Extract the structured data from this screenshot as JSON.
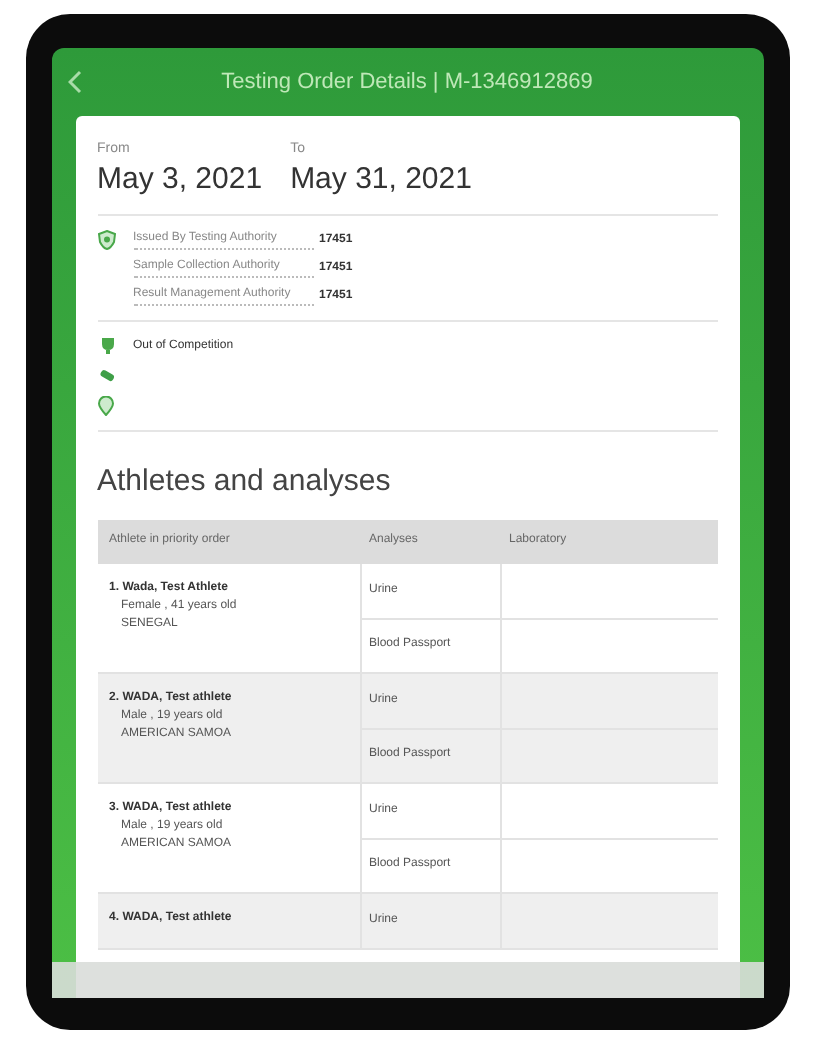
{
  "header": {
    "title": "Testing Order Details | M-1346912869"
  },
  "dates": [
    {
      "label": "From",
      "value": "May 3, 2021"
    },
    {
      "label": "To",
      "value": "May 31, 2021"
    }
  ],
  "authorities": [
    {
      "label": "Issued By Testing Authority",
      "value": "17451"
    },
    {
      "label": "Sample Collection Authority",
      "value": "17451"
    },
    {
      "label": "Result Management Authority",
      "value": "17451"
    }
  ],
  "competition": {
    "label": "Out of Competition"
  },
  "section_title": "Athletes and analyses",
  "table": {
    "columns": [
      "Athlete in priority order",
      "Analyses",
      "Laboratory"
    ],
    "rows": [
      {
        "number": "1.",
        "name": "Wada, Test Athlete",
        "details": "Female , 41 years old",
        "country": "SENEGAL",
        "analyses": [
          "Urine",
          "Blood Passport"
        ]
      },
      {
        "number": "2.",
        "name": "WADA, Test athlete",
        "details": "Male , 19 years old",
        "country": "AMERICAN SAMOA",
        "analyses": [
          "Urine",
          "Blood Passport"
        ]
      },
      {
        "number": "3.",
        "name": "WADA, Test athlete",
        "details": "Male , 19 years old",
        "country": "AMERICAN SAMOA",
        "analyses": [
          "Urine",
          "Blood Passport"
        ]
      },
      {
        "number": "4.",
        "name": "WADA, Test athlete",
        "analyses": [
          "Urine"
        ]
      }
    ]
  }
}
